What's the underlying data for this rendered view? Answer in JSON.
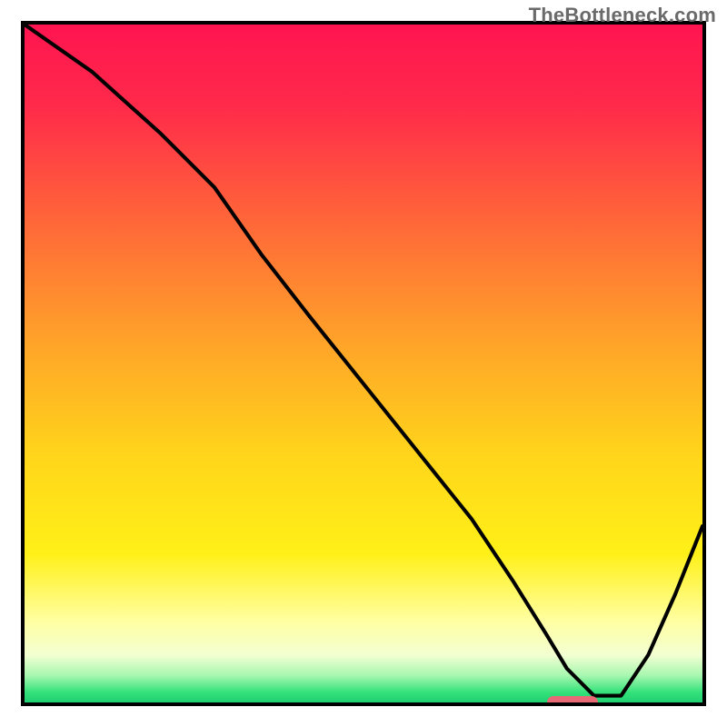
{
  "watermark": "TheBottleneck.com",
  "chart_data": {
    "type": "line",
    "title": "",
    "xlabel": "",
    "ylabel": "",
    "xlim": [
      0,
      100
    ],
    "ylim": [
      0,
      100
    ],
    "x": [
      0,
      10,
      20,
      28,
      35,
      42,
      50,
      58,
      66,
      72,
      77,
      80,
      84,
      88,
      92,
      96,
      100
    ],
    "values": [
      100,
      93,
      84,
      76,
      66,
      57,
      47,
      37,
      27,
      18,
      10,
      5,
      1,
      1,
      7,
      16,
      26
    ],
    "gradient_stops": [
      {
        "pos": 0.0,
        "color": "#ff1450"
      },
      {
        "pos": 0.12,
        "color": "#ff2a4a"
      },
      {
        "pos": 0.3,
        "color": "#ff6a38"
      },
      {
        "pos": 0.48,
        "color": "#ffa728"
      },
      {
        "pos": 0.64,
        "color": "#ffd61a"
      },
      {
        "pos": 0.78,
        "color": "#fff018"
      },
      {
        "pos": 0.88,
        "color": "#ffffa2"
      },
      {
        "pos": 0.93,
        "color": "#f3ffd2"
      },
      {
        "pos": 0.96,
        "color": "#a8f7b0"
      },
      {
        "pos": 0.985,
        "color": "#34e27a"
      },
      {
        "pos": 1.0,
        "color": "#20cf72"
      }
    ],
    "marker": {
      "x_center": 80,
      "y": 1,
      "width_pct": 7.5
    }
  }
}
